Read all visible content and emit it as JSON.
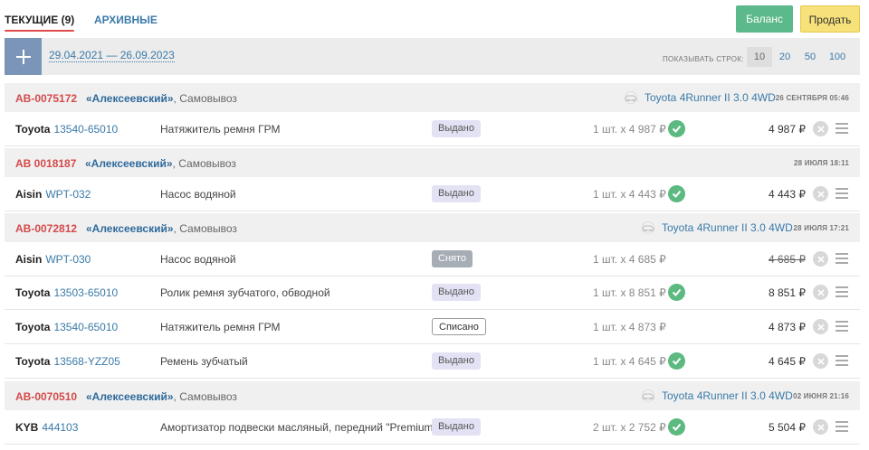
{
  "tabs": {
    "current": "ТЕКУЩИЕ (9)",
    "archive": "АРХИВНЫЕ"
  },
  "buttons": {
    "balance": "Баланс",
    "sell": "Продать"
  },
  "filter": {
    "date_range": "29.04.2021 — 26.09.2023",
    "rows_label": "ПОКАЗЫВАТЬ СТРОК:",
    "rows_options": [
      "10",
      "20",
      "50",
      "100"
    ],
    "rows_selected": "10"
  },
  "colors": {
    "order_id": "#d44a4a",
    "link": "#3a7aa8",
    "ok": "#5cb980"
  },
  "orders": [
    {
      "id": "АВ-0075172",
      "shop": "«Алексеевский»",
      "delivery": ", Самовывоз",
      "car": "Toyota 4Runner II 3.0 4WD",
      "date": "26 СЕНТЯБРЯ 05:46",
      "items": [
        {
          "brand": "Toyota",
          "part": "13540-65010",
          "desc": "Натяжитель ремня ГРМ",
          "status": "Выдано",
          "qty": "1 шт. x 4 987 ₽",
          "total": "4 987 ₽"
        }
      ]
    },
    {
      "id": "АВ 0018187",
      "shop": "«Алексеевский»",
      "delivery": ", Самовывоз",
      "car": "",
      "date": "28 ИЮЛЯ 18:11",
      "items": [
        {
          "brand": "Aisin",
          "part": "WPT-032",
          "desc": "Насос водяной",
          "status": "Выдано",
          "qty": "1 шт. x 4 443 ₽",
          "total": "4 443 ₽"
        }
      ]
    },
    {
      "id": "АВ-0072812",
      "shop": "«Алексеевский»",
      "delivery": ", Самовывоз",
      "car": "Toyota 4Runner II 3.0 4WD",
      "date": "28 ИЮЛЯ 17:21",
      "items": [
        {
          "brand": "Aisin",
          "part": "WPT-030",
          "desc": "Насос водяной",
          "status": "Снято",
          "qty": "1 шт. x 4 685 ₽",
          "total": "4 685 ₽"
        },
        {
          "brand": "Toyota",
          "part": "13503-65010",
          "desc": "Ролик ремня зубчатого, обводной",
          "status": "Выдано",
          "qty": "1 шт. x 8 851 ₽",
          "total": "8 851 ₽"
        },
        {
          "brand": "Toyota",
          "part": "13540-65010",
          "desc": "Натяжитель ремня ГРМ",
          "status": "Списано",
          "qty": "1 шт. x 4 873 ₽",
          "total": "4 873 ₽"
        },
        {
          "brand": "Toyota",
          "part": "13568-YZZ05",
          "desc": "Ремень зубчатый",
          "status": "Выдано",
          "qty": "1 шт. x 4 645 ₽",
          "total": "4 645 ₽"
        }
      ]
    },
    {
      "id": "АВ-0070510",
      "shop": "«Алексеевский»",
      "delivery": ", Самовывоз",
      "car": "Toyota 4Runner II 3.0 4WD",
      "date": "02 ИЮНЯ 21:16",
      "items": [
        {
          "brand": "KYB",
          "part": "444103",
          "desc": "Амортизатор подвески масляный, передний \"Premium\"",
          "status": "Выдано",
          "qty": "2 шт. x 2 752 ₽",
          "total": "5 504 ₽"
        }
      ]
    }
  ]
}
